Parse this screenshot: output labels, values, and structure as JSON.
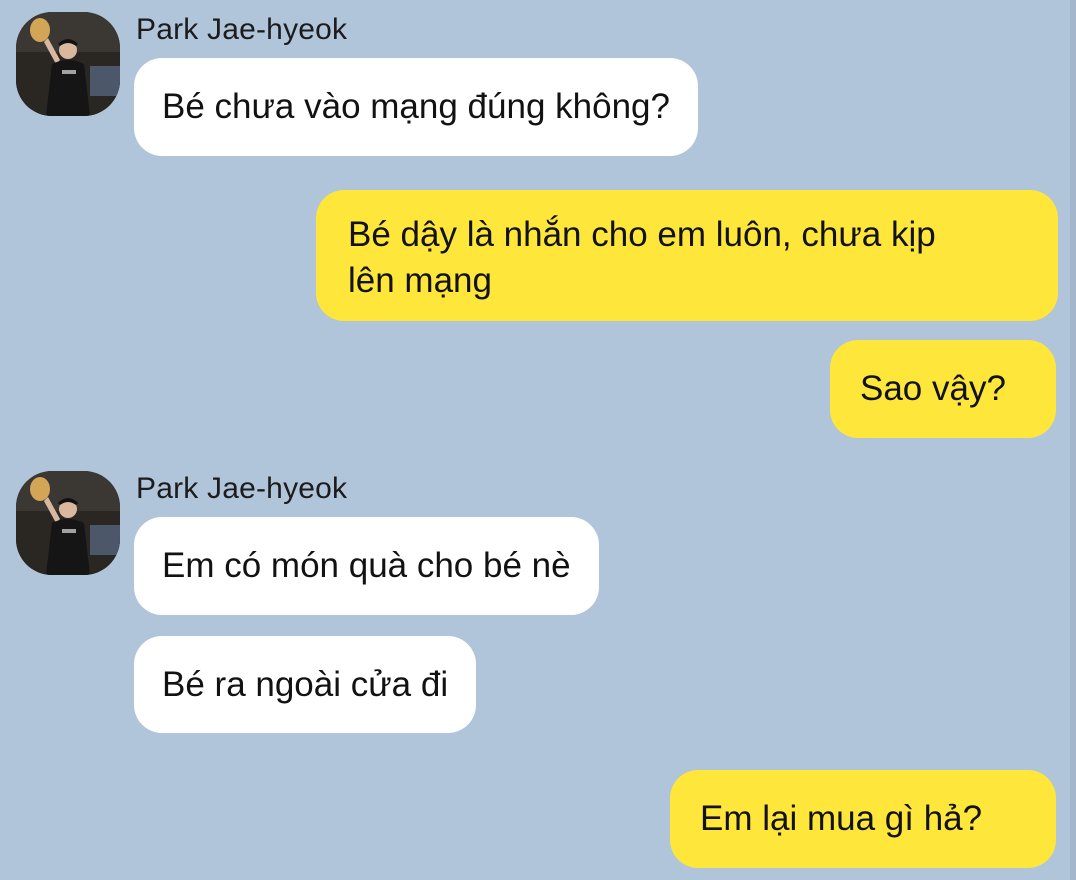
{
  "conversation": {
    "messages": [
      {
        "sender": "Park Jae-hyeok",
        "direction": "incoming",
        "show_header": true,
        "text": "Bé chưa vào mạng đúng không?"
      },
      {
        "sender": "me",
        "direction": "outgoing",
        "text_line1": "Bé dậy là nhắn cho em luôn, chưa kịp",
        "text_line2": "lên mạng"
      },
      {
        "sender": "me",
        "direction": "outgoing",
        "text": "Sao vậy?"
      },
      {
        "sender": "Park Jae-hyeok",
        "direction": "incoming",
        "show_header": true,
        "text": "Em có món quà cho bé nè"
      },
      {
        "sender": "Park Jae-hyeok",
        "direction": "incoming",
        "show_header": false,
        "text": "Bé ra ngoài cửa đi"
      },
      {
        "sender": "me",
        "direction": "outgoing",
        "text": "Em lại mua gì hả?"
      }
    ]
  },
  "contact": {
    "name": "Park Jae-hyeok",
    "avatar_icon": "profile-photo-icon"
  },
  "colors": {
    "background": "#b0c4da",
    "incoming_bubble": "#ffffff",
    "outgoing_bubble": "#fee63b",
    "text": "#121212"
  }
}
